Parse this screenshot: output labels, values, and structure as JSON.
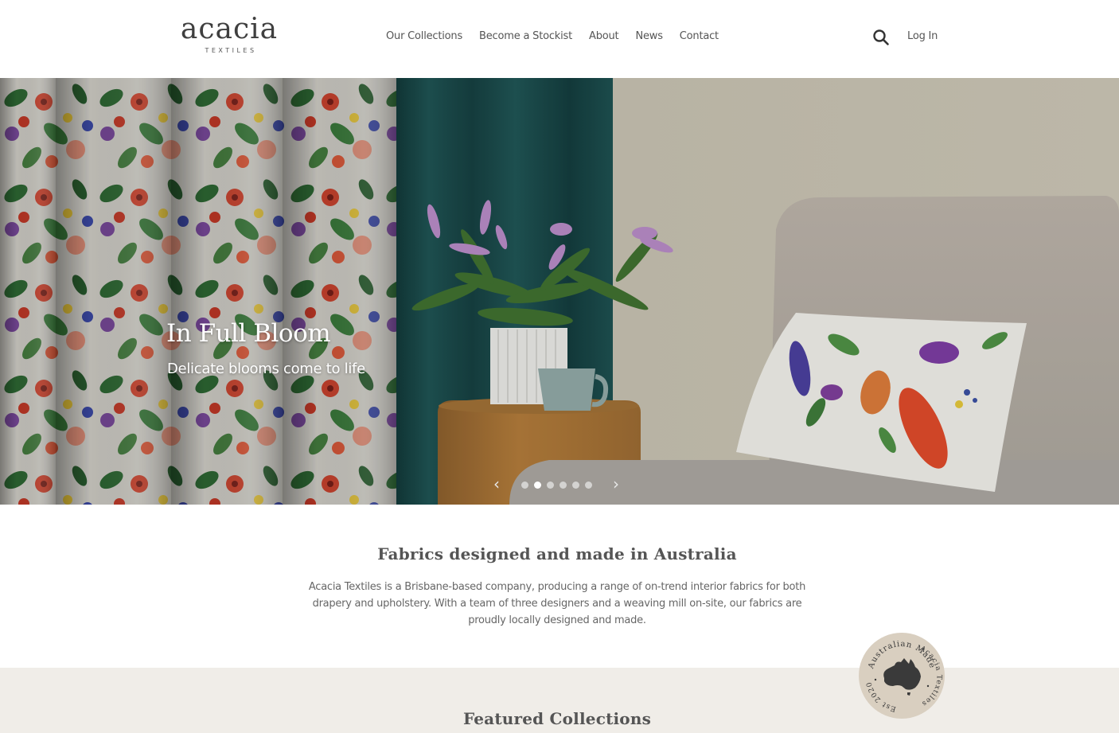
{
  "header": {
    "logo": {
      "word": "acacia",
      "sub": "TEXTILES"
    },
    "nav": [
      {
        "label": "Our Collections"
      },
      {
        "label": "Become a Stockist"
      },
      {
        "label": "About"
      },
      {
        "label": "News"
      },
      {
        "label": "Contact"
      }
    ],
    "search_icon": "search-icon",
    "login_label": "Log In"
  },
  "hero": {
    "title": "In Full Bloom",
    "subtitle": "Delicate blooms come to life",
    "prev_glyph": "‹",
    "next_glyph": "›",
    "slide_count": 6,
    "active_slide": 2
  },
  "intro": {
    "title": "Fabrics designed and made in Australia",
    "body": "Acacia Textiles is a Brisbane-based company, producing a range of on-trend interior fabrics for both drapery and upholstery. With a team of three designers and a weaving mill on-site, our fabrics are proudly locally designed and made."
  },
  "badge": {
    "top_text": "Australian Made",
    "right_text": "Acacia Textiles",
    "left_text": "Est 2020"
  },
  "featured": {
    "title": "Featured Collections"
  },
  "colors": {
    "text": "#555555",
    "featured_bg": "#f0ede8",
    "badge_bg": "#d9cfc0",
    "badge_ink": "#3a3a3a",
    "curtain_teal": "#1c4a4a"
  }
}
